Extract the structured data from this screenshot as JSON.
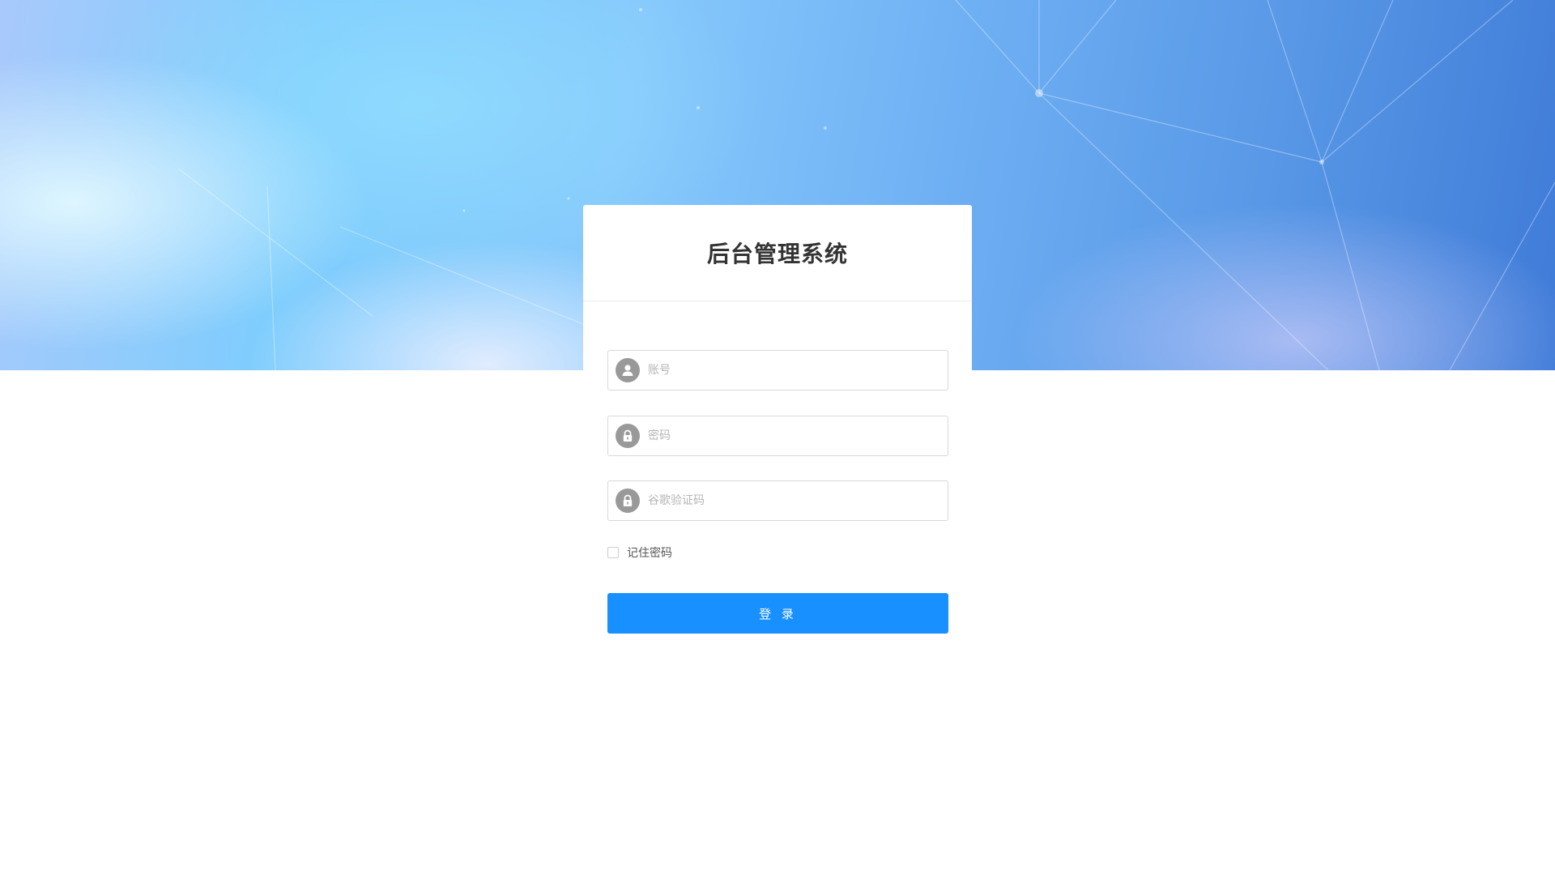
{
  "login": {
    "title": "后台管理系统",
    "account": {
      "placeholder": "账号",
      "value": "",
      "icon": "user-icon"
    },
    "password": {
      "placeholder": "密码",
      "value": "",
      "icon": "lock-icon"
    },
    "google_code": {
      "placeholder": "谷歌验证码",
      "value": "",
      "icon": "lock-icon"
    },
    "remember": {
      "label": "记住密码",
      "checked": false
    },
    "submit_label": "登 录"
  },
  "colors": {
    "primary": "#1890ff",
    "icon_bg": "#999999",
    "title": "#333333"
  }
}
